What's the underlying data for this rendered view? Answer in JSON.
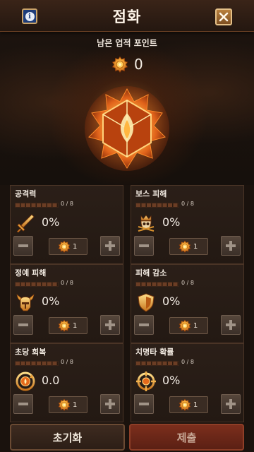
{
  "header": {
    "title": "점화",
    "info_icon": "info-icon",
    "close_icon": "close-icon"
  },
  "points": {
    "label": "남은 업적 포인트",
    "value": "0",
    "icon": "ember-coin-icon"
  },
  "colors": {
    "accent": "#f2a33a",
    "submit_bg": "#6a2617",
    "panel_bg": "#2b1f18"
  },
  "stats": [
    {
      "name": "공격력",
      "progress": "0 / 8",
      "progress_fraction": 0,
      "value": "0%",
      "icon": "sword-icon",
      "cost": "1"
    },
    {
      "name": "보스 피해",
      "progress": "0 / 8",
      "progress_fraction": 0,
      "value": "0%",
      "icon": "skull-crown-icon",
      "cost": "1"
    },
    {
      "name": "정예 피해",
      "progress": "0 / 8",
      "progress_fraction": 0,
      "value": "0%",
      "icon": "horned-helmet-icon",
      "cost": "1"
    },
    {
      "name": "피해 감소",
      "progress": "0 / 8",
      "progress_fraction": 0,
      "value": "0%",
      "icon": "shield-icon",
      "cost": "1"
    },
    {
      "name": "초당 회복",
      "progress": "0 / 8",
      "progress_fraction": 0,
      "value": "0.0",
      "icon": "regen-icon",
      "cost": "1"
    },
    {
      "name": "치명타 확률",
      "progress": "0 / 8",
      "progress_fraction": 0,
      "value": "0%",
      "icon": "crosshair-icon",
      "cost": "1"
    }
  ],
  "footer": {
    "reset_label": "초기화",
    "submit_label": "제출"
  }
}
